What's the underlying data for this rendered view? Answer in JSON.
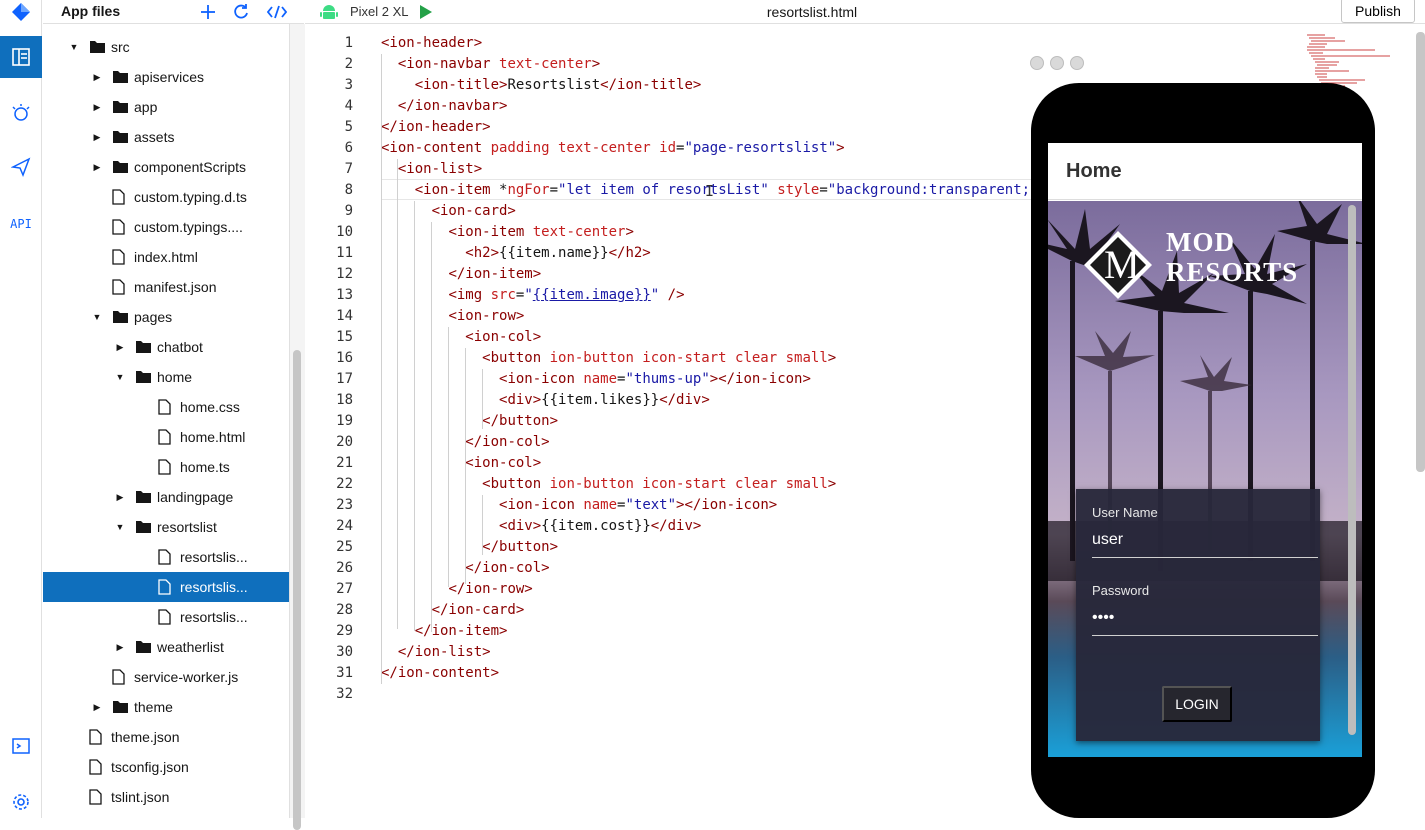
{
  "file_panel": {
    "title": "App files",
    "tree": [
      {
        "label": "src",
        "depth": 2,
        "type": "folder",
        "state": "open"
      },
      {
        "label": "apiservices",
        "depth": 3,
        "type": "folder",
        "state": "closed"
      },
      {
        "label": "app",
        "depth": 3,
        "type": "folder",
        "state": "closed"
      },
      {
        "label": "assets",
        "depth": 3,
        "type": "folder",
        "state": "closed"
      },
      {
        "label": "componentScripts",
        "depth": 3,
        "type": "folder",
        "state": "closed"
      },
      {
        "label": "custom.typing.d.ts",
        "depth": 3,
        "type": "file"
      },
      {
        "label": "custom.typings....",
        "depth": 3,
        "type": "file"
      },
      {
        "label": "index.html",
        "depth": 3,
        "type": "file"
      },
      {
        "label": "manifest.json",
        "depth": 3,
        "type": "file"
      },
      {
        "label": "pages",
        "depth": 3,
        "type": "folder",
        "state": "open"
      },
      {
        "label": "chatbot",
        "depth": 4,
        "type": "folder",
        "state": "closed"
      },
      {
        "label": "home",
        "depth": 4,
        "type": "folder",
        "state": "open"
      },
      {
        "label": "home.css",
        "depth": 5,
        "type": "file"
      },
      {
        "label": "home.html",
        "depth": 5,
        "type": "file"
      },
      {
        "label": "home.ts",
        "depth": 5,
        "type": "file"
      },
      {
        "label": "landingpage",
        "depth": 4,
        "type": "folder",
        "state": "closed"
      },
      {
        "label": "resortslist",
        "depth": 4,
        "type": "folder",
        "state": "open"
      },
      {
        "label": "resortslis...",
        "depth": 5,
        "type": "file"
      },
      {
        "label": "resortslis...",
        "depth": 5,
        "type": "file",
        "selected": true
      },
      {
        "label": "resortslis...",
        "depth": 5,
        "type": "file"
      },
      {
        "label": "weatherlist",
        "depth": 4,
        "type": "folder",
        "state": "closed"
      },
      {
        "label": "service-worker.js",
        "depth": 3,
        "type": "file"
      },
      {
        "label": "theme",
        "depth": 3,
        "type": "folder",
        "state": "closed"
      },
      {
        "label": "theme.json",
        "depth": 2,
        "type": "file"
      },
      {
        "label": "tsconfig.json",
        "depth": 2,
        "type": "file"
      },
      {
        "label": "tslint.json",
        "depth": 2,
        "type": "file"
      }
    ]
  },
  "topbar": {
    "device": "Pixel 2 XL",
    "file_title": "resortslist.html",
    "publish_label": "Publish"
  },
  "editor": {
    "lines": [
      [
        [
          "tg",
          "<ion-header>"
        ]
      ],
      [
        [
          "t",
          "  "
        ],
        [
          "tg",
          "<ion-navbar "
        ],
        [
          "at",
          "text-center"
        ],
        [
          "tg",
          ">"
        ]
      ],
      [
        [
          "t",
          "    "
        ],
        [
          "tg",
          "<ion-title>"
        ],
        [
          "t",
          "Resortslist"
        ],
        [
          "tg",
          "</ion-title>"
        ]
      ],
      [
        [
          "t",
          "  "
        ],
        [
          "tg",
          "</ion-navbar>"
        ]
      ],
      [
        [
          "tg",
          "</ion-header>"
        ]
      ],
      [
        [
          "tg",
          "<ion-content "
        ],
        [
          "at",
          "padding text-center id"
        ],
        [
          "t",
          "="
        ],
        [
          "st",
          "\"page-resortslist\""
        ],
        [
          "tg",
          ">"
        ]
      ],
      [
        [
          "t",
          "  "
        ],
        [
          "tg",
          "<ion-list>"
        ]
      ],
      [
        [
          "t",
          "    "
        ],
        [
          "tg",
          "<ion-item "
        ],
        [
          "t",
          "*"
        ],
        [
          "at",
          "ngFor"
        ],
        [
          "t",
          "="
        ],
        [
          "st",
          "\"let item of resortsList\""
        ],
        [
          "t",
          " "
        ],
        [
          "at",
          "style"
        ],
        [
          "t",
          "="
        ],
        [
          "st",
          "\"background:transparent;\""
        ]
      ],
      [
        [
          "t",
          "      "
        ],
        [
          "tg",
          "<ion-card>"
        ]
      ],
      [
        [
          "t",
          "        "
        ],
        [
          "tg",
          "<ion-item "
        ],
        [
          "at",
          "text-center"
        ],
        [
          "tg",
          ">"
        ]
      ],
      [
        [
          "t",
          "          "
        ],
        [
          "tg",
          "<h2>"
        ],
        [
          "t",
          "{{item.name}}"
        ],
        [
          "tg",
          "</h2>"
        ]
      ],
      [
        [
          "t",
          "        "
        ],
        [
          "tg",
          "</ion-item>"
        ]
      ],
      [
        [
          "t",
          "        "
        ],
        [
          "tg",
          "<img "
        ],
        [
          "at",
          "src"
        ],
        [
          "t",
          "="
        ],
        [
          "st",
          "\""
        ],
        [
          "lk",
          "{{item.image}}"
        ],
        [
          "st",
          "\""
        ],
        [
          "t",
          " "
        ],
        [
          "tg",
          "/>"
        ]
      ],
      [
        [
          "t",
          "        "
        ],
        [
          "tg",
          "<ion-row>"
        ]
      ],
      [
        [
          "t",
          "          "
        ],
        [
          "tg",
          "<ion-col>"
        ]
      ],
      [
        [
          "t",
          "            "
        ],
        [
          "tg",
          "<button "
        ],
        [
          "at",
          "ion-button icon-start clear small"
        ],
        [
          "tg",
          ">"
        ]
      ],
      [
        [
          "t",
          "              "
        ],
        [
          "tg",
          "<ion-icon "
        ],
        [
          "at",
          "name"
        ],
        [
          "t",
          "="
        ],
        [
          "st",
          "\"thums-up\""
        ],
        [
          "tg",
          "></ion-icon>"
        ]
      ],
      [
        [
          "t",
          "              "
        ],
        [
          "tg",
          "<div>"
        ],
        [
          "t",
          "{{item.likes}}"
        ],
        [
          "tg",
          "</div>"
        ]
      ],
      [
        [
          "t",
          "            "
        ],
        [
          "tg",
          "</button>"
        ]
      ],
      [
        [
          "t",
          "          "
        ],
        [
          "tg",
          "</ion-col>"
        ]
      ],
      [
        [
          "t",
          "          "
        ],
        [
          "tg",
          "<ion-col>"
        ]
      ],
      [
        [
          "t",
          "            "
        ],
        [
          "tg",
          "<button "
        ],
        [
          "at",
          "ion-button icon-start clear small"
        ],
        [
          "tg",
          ">"
        ]
      ],
      [
        [
          "t",
          "              "
        ],
        [
          "tg",
          "<ion-icon "
        ],
        [
          "at",
          "name"
        ],
        [
          "t",
          "="
        ],
        [
          "st",
          "\"text\""
        ],
        [
          "tg",
          "></ion-icon>"
        ]
      ],
      [
        [
          "t",
          "              "
        ],
        [
          "tg",
          "<div>"
        ],
        [
          "t",
          "{{item.cost}}"
        ],
        [
          "tg",
          "</div>"
        ]
      ],
      [
        [
          "t",
          "            "
        ],
        [
          "tg",
          "</button>"
        ]
      ],
      [
        [
          "t",
          "          "
        ],
        [
          "tg",
          "</ion-col>"
        ]
      ],
      [
        [
          "t",
          "        "
        ],
        [
          "tg",
          "</ion-row>"
        ]
      ],
      [
        [
          "t",
          "      "
        ],
        [
          "tg",
          "</ion-card>"
        ]
      ],
      [
        [
          "t",
          "    "
        ],
        [
          "tg",
          "</ion-item>"
        ]
      ],
      [
        [
          "t",
          "  "
        ],
        [
          "tg",
          "</ion-list>"
        ]
      ],
      [
        [
          "tg",
          "</ion-content>"
        ]
      ],
      []
    ]
  },
  "preview": {
    "app_title": "Home",
    "logo_line1": "MOD",
    "logo_line2": "RESORTS",
    "logo_letter": "M",
    "username_label": "User Name",
    "username_value": "user",
    "password_label": "Password",
    "password_value": "••••",
    "login_label": "LOGIN"
  }
}
